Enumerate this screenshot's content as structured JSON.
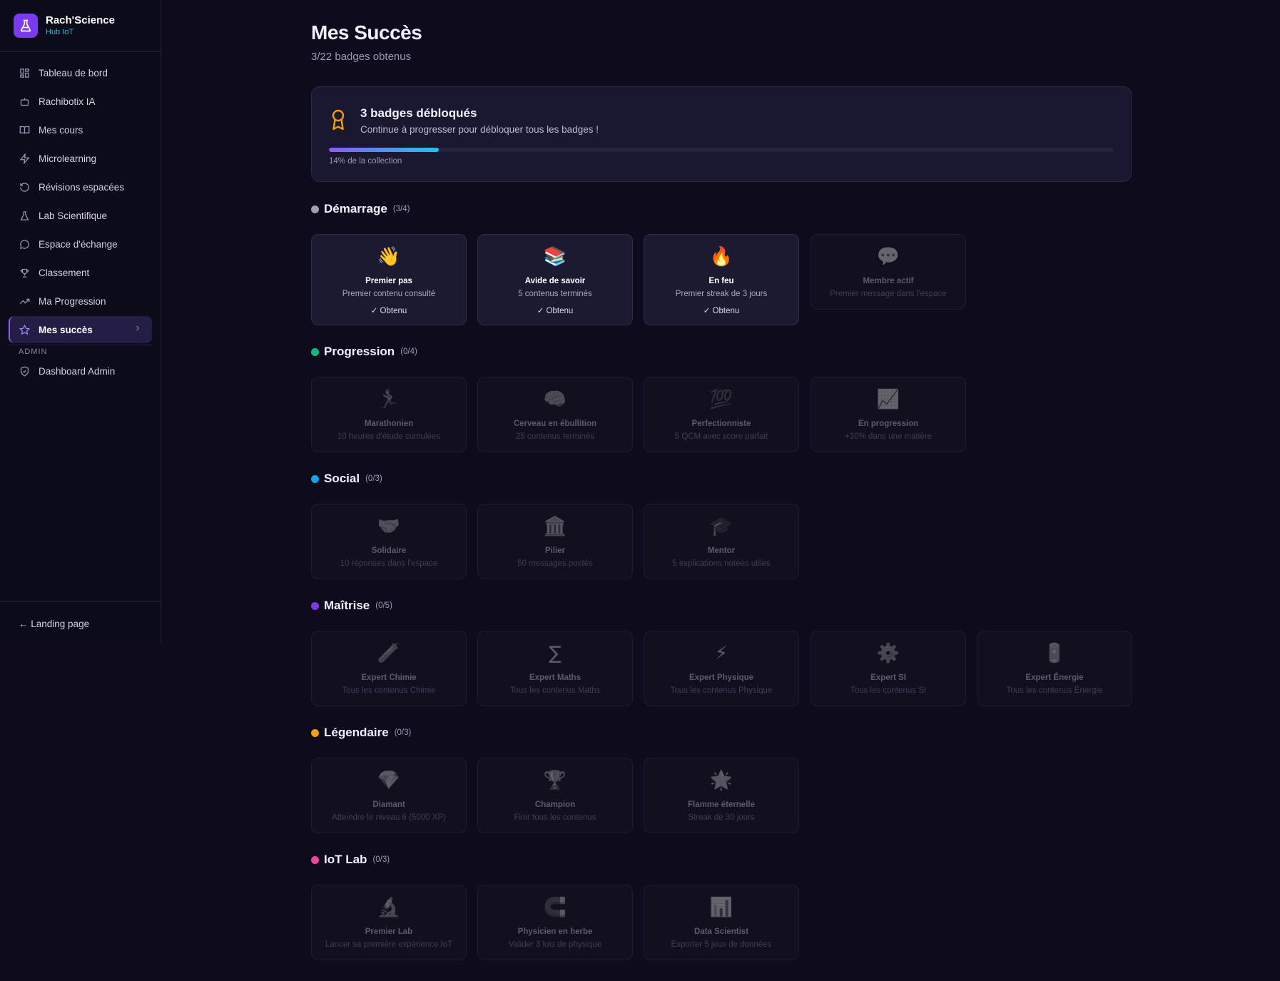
{
  "brand": {
    "name": "Rach'Science",
    "sub": "Hub IoT"
  },
  "nav": {
    "items": [
      {
        "label": "Tableau de bord",
        "icon": "dashboard-icon"
      },
      {
        "label": "Rachibotix IA",
        "icon": "bot-icon"
      },
      {
        "label": "Mes cours",
        "icon": "book-icon"
      },
      {
        "label": "Microlearning",
        "icon": "lightning-icon"
      },
      {
        "label": "Révisions espacées",
        "icon": "refresh-icon"
      },
      {
        "label": "Lab Scientifique",
        "icon": "flask-icon"
      },
      {
        "label": "Espace d'échange",
        "icon": "chat-icon"
      },
      {
        "label": "Classement",
        "icon": "trophy-icon"
      },
      {
        "label": "Ma Progression",
        "icon": "trend-icon"
      },
      {
        "label": "Mes succès",
        "icon": "star-icon",
        "active": true
      }
    ],
    "admin_label": "ADMIN",
    "admin_items": [
      {
        "label": "Dashboard Admin",
        "icon": "shield-icon"
      }
    ],
    "footer": "← Landing page"
  },
  "page": {
    "title": "Mes Succès",
    "subtitle": "3/22 badges obtenus"
  },
  "summary": {
    "title": "3 badges débloqués",
    "message": "Continue à progresser pour débloquer tous les badges !",
    "progress_percent": 14,
    "progress_label": "14% de la collection"
  },
  "colors": {
    "accent": "#8b5cf6",
    "demarrage": "#9ca3af",
    "progression": "#10b981",
    "social": "#0ea5e9",
    "maitrise": "#7c3aed",
    "legendaire": "#f59e0b",
    "iotlab": "#ec4899"
  },
  "sections": [
    {
      "title": "Démarrage",
      "count": "(3/4)",
      "badges": [
        {
          "emoji": "👋",
          "name": "Premier pas",
          "desc": "Premier contenu consulté",
          "status": "✓ Obtenu",
          "unlocked": true
        },
        {
          "emoji": "📚",
          "name": "Avide de savoir",
          "desc": "5 contenus terminés",
          "status": "✓ Obtenu",
          "unlocked": true
        },
        {
          "emoji": "🔥",
          "name": "En feu",
          "desc": "Premier streak de 3 jours",
          "status": "✓ Obtenu",
          "unlocked": true
        },
        {
          "emoji": "💬",
          "name": "Membre actif",
          "desc": "Premier message dans l'espace",
          "unlocked": false
        }
      ]
    },
    {
      "title": "Progression",
      "count": "(0/4)",
      "badges": [
        {
          "emoji": "🏃",
          "name": "Marathonien",
          "desc": "10 heures d'étude cumulées",
          "unlocked": false
        },
        {
          "emoji": "🧠",
          "name": "Cerveau en ébullition",
          "desc": "25 contenus terminés",
          "unlocked": false
        },
        {
          "emoji": "💯",
          "name": "Perfectionniste",
          "desc": "5 QCM avec score parfait",
          "unlocked": false
        },
        {
          "emoji": "📈",
          "name": "En progression",
          "desc": "+30% dans une matière",
          "unlocked": false
        }
      ]
    },
    {
      "title": "Social",
      "count": "(0/3)",
      "badges": [
        {
          "emoji": "🤝",
          "name": "Solidaire",
          "desc": "10 réponses dans l'espace",
          "unlocked": false
        },
        {
          "emoji": "🏛️",
          "name": "Pilier",
          "desc": "50 messages postés",
          "unlocked": false
        },
        {
          "emoji": "🎓",
          "name": "Mentor",
          "desc": "5 explications notées utiles",
          "unlocked": false
        }
      ]
    },
    {
      "title": "Maîtrise",
      "count": "(0/5)",
      "badges": [
        {
          "emoji": "🧪",
          "name": "Expert Chimie",
          "desc": "Tous les contenus Chimie",
          "unlocked": false
        },
        {
          "emoji": "∑",
          "name": "Expert Maths",
          "desc": "Tous les contenus Maths",
          "unlocked": false
        },
        {
          "emoji": "⚡",
          "name": "Expert Physique",
          "desc": "Tous les contenus Physique",
          "unlocked": false
        },
        {
          "emoji": "⚙️",
          "name": "Expert SI",
          "desc": "Tous les contenus SI",
          "unlocked": false
        },
        {
          "emoji": "🔋",
          "name": "Expert Énergie",
          "desc": "Tous les contenus Énergie",
          "unlocked": false
        }
      ]
    },
    {
      "title": "Légendaire",
      "count": "(0/3)",
      "badges": [
        {
          "emoji": "💎",
          "name": "Diamant",
          "desc": "Atteindre le niveau 6 (5000 XP)",
          "unlocked": false
        },
        {
          "emoji": "🏆",
          "name": "Champion",
          "desc": "Finir tous les contenus",
          "unlocked": false
        },
        {
          "emoji": "🌟",
          "name": "Flamme éternelle",
          "desc": "Streak de 30 jours",
          "unlocked": false
        }
      ]
    },
    {
      "title": "IoT Lab",
      "count": "(0/3)",
      "badges": [
        {
          "emoji": "🔬",
          "name": "Premier Lab",
          "desc": "Lancer sa première expérience IoT",
          "unlocked": false
        },
        {
          "emoji": "🧲",
          "name": "Physicien en herbe",
          "desc": "Valider 3 lois de physique",
          "unlocked": false
        },
        {
          "emoji": "📊",
          "name": "Data Scientist",
          "desc": "Exporter 5 jeux de données",
          "unlocked": false
        }
      ]
    }
  ]
}
